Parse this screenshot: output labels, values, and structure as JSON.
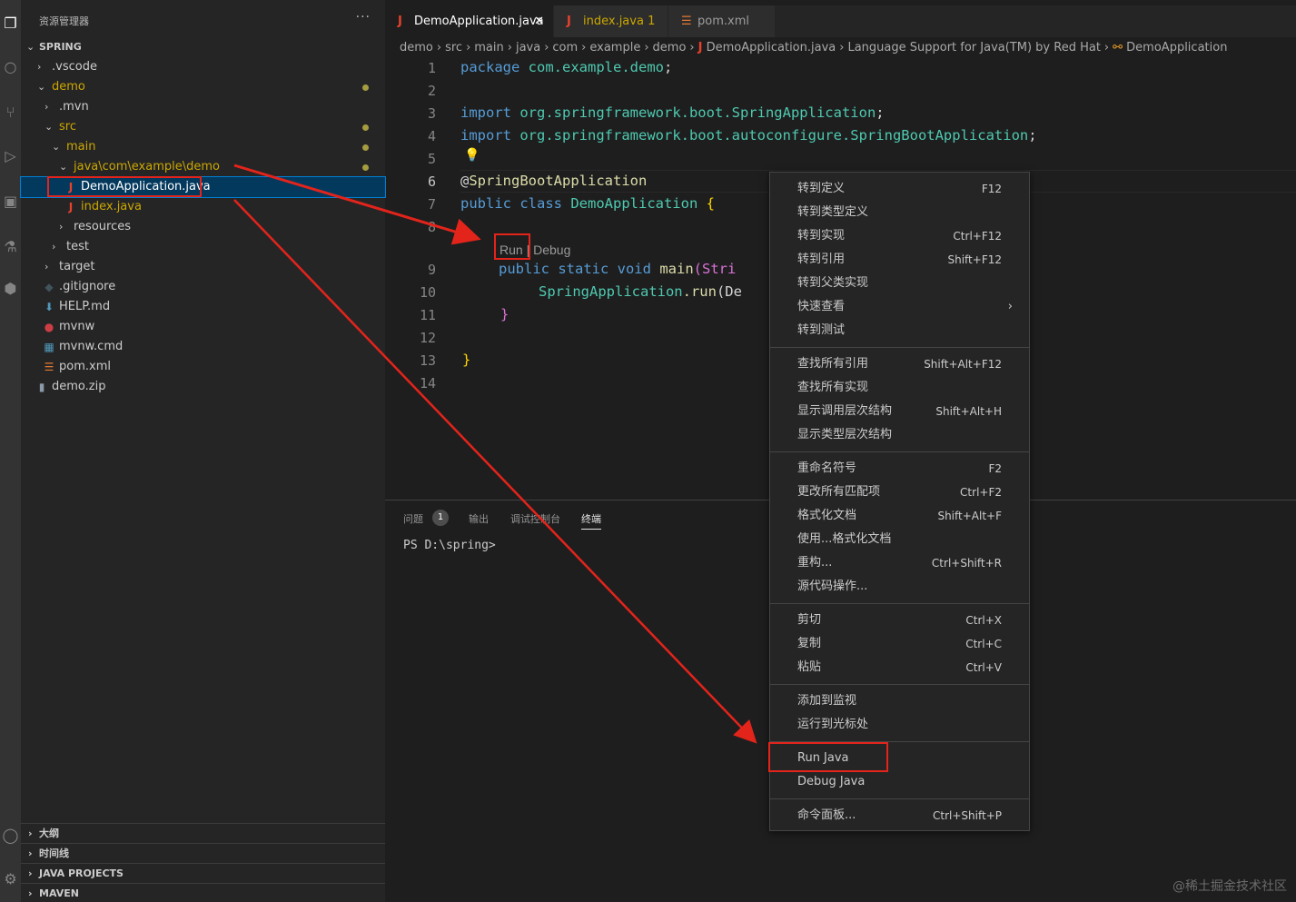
{
  "explorer": {
    "title": "资源管理器",
    "more": "···",
    "root": "SPRING",
    "items": [
      {
        "label": ".vscode",
        "chev": "›"
      },
      {
        "label": "demo",
        "chev": "⌄"
      },
      {
        "label": ".mvn",
        "chev": "›"
      },
      {
        "label": "src",
        "chev": "⌄"
      },
      {
        "label": "main",
        "chev": "⌄"
      },
      {
        "label": "java\\com\\example\\demo",
        "chev": "⌄"
      },
      {
        "label": "DemoApplication.java",
        "icon": "J"
      },
      {
        "label": "index.java",
        "icon": "J"
      },
      {
        "label": "resources",
        "chev": "›"
      },
      {
        "label": "test",
        "chev": "›"
      },
      {
        "label": "target",
        "chev": "›"
      },
      {
        "label": ".gitignore",
        "icon": "◆"
      },
      {
        "label": "HELP.md",
        "icon": "⬇"
      },
      {
        "label": "mvnw",
        "icon": "●"
      },
      {
        "label": "mvnw.cmd",
        "icon": "▦"
      },
      {
        "label": "pom.xml",
        "icon": "☰"
      },
      {
        "label": "demo.zip",
        "icon": "▮"
      }
    ],
    "sections": [
      "大纲",
      "时间线",
      "JAVA PROJECTS",
      "MAVEN"
    ]
  },
  "tabs": [
    {
      "label": "DemoApplication.java",
      "icon": "J",
      "close": "✕"
    },
    {
      "label": "index.java 1",
      "icon": "J"
    },
    {
      "label": "pom.xml",
      "icon": "☰"
    }
  ],
  "breadcrumb": [
    "demo",
    "src",
    "main",
    "java",
    "com",
    "example",
    "demo",
    "DemoApplication.java",
    "Language Support for Java(TM) by Red Hat",
    "DemoApplication"
  ],
  "code": {
    "line_numbers": [
      "1",
      "2",
      "3",
      "4",
      "5",
      "6",
      "7",
      "8",
      "9",
      "10",
      "11",
      "12",
      "13",
      "14"
    ],
    "l1a": "package",
    "l1b": "com.example.demo",
    "l1c": ";",
    "l3a": "import",
    "l3b": "org.springframework.boot.SpringApplication",
    "l3c": ";",
    "l4a": "import",
    "l4b": "org.springframework.boot.autoconfigure.SpringBootApplication",
    "l4c": ";",
    "l6a": "@",
    "l6b": "SpringBootApplication",
    "l7a": "public class",
    "l7b": "DemoApplication",
    "l7c": "{",
    "codelens_run": "Run",
    "codelens_sep": "|",
    "codelens_debug": "Debug",
    "l9a": "public static void",
    "l9b": "main",
    "l9c": "(Stri",
    "l10a": "SpringApplication",
    "l10b": ".run",
    "l10c": "(De",
    "l11": "}",
    "l13": "}"
  },
  "panel": {
    "tabs": [
      "问题",
      "输出",
      "调试控制台",
      "终端"
    ],
    "badge": "1",
    "terminal_line": "PS D:\\spring>"
  },
  "context_menu": {
    "groups": [
      [
        {
          "label": "转到定义",
          "key": "F12"
        },
        {
          "label": "转到类型定义",
          "key": ""
        },
        {
          "label": "转到实现",
          "key": "Ctrl+F12"
        },
        {
          "label": "转到引用",
          "key": "Shift+F12"
        },
        {
          "label": "转到父类实现",
          "key": ""
        },
        {
          "label": "快速查看",
          "key": "",
          "sub": "›"
        },
        {
          "label": "转到测试",
          "key": ""
        }
      ],
      [
        {
          "label": "查找所有引用",
          "key": "Shift+Alt+F12"
        },
        {
          "label": "查找所有实现",
          "key": ""
        },
        {
          "label": "显示调用层次结构",
          "key": "Shift+Alt+H"
        },
        {
          "label": "显示类型层次结构",
          "key": ""
        }
      ],
      [
        {
          "label": "重命名符号",
          "key": "F2"
        },
        {
          "label": "更改所有匹配项",
          "key": "Ctrl+F2"
        },
        {
          "label": "格式化文档",
          "key": "Shift+Alt+F"
        },
        {
          "label": "使用...格式化文档",
          "key": ""
        },
        {
          "label": "重构...",
          "key": "Ctrl+Shift+R"
        },
        {
          "label": "源代码操作...",
          "key": ""
        }
      ],
      [
        {
          "label": "剪切",
          "key": "Ctrl+X"
        },
        {
          "label": "复制",
          "key": "Ctrl+C"
        },
        {
          "label": "粘贴",
          "key": "Ctrl+V"
        }
      ],
      [
        {
          "label": "添加到监视",
          "key": ""
        },
        {
          "label": "运行到光标处",
          "key": ""
        }
      ],
      [
        {
          "label": "Run Java",
          "key": ""
        },
        {
          "label": "Debug Java",
          "key": ""
        }
      ],
      [
        {
          "label": "命令面板...",
          "key": "Ctrl+Shift+P"
        }
      ]
    ]
  },
  "watermark": "@稀土掘金技术社区",
  "colors": {
    "annotation_red": "#e3241b",
    "selection": "#04395e",
    "modified": "#cca700"
  }
}
